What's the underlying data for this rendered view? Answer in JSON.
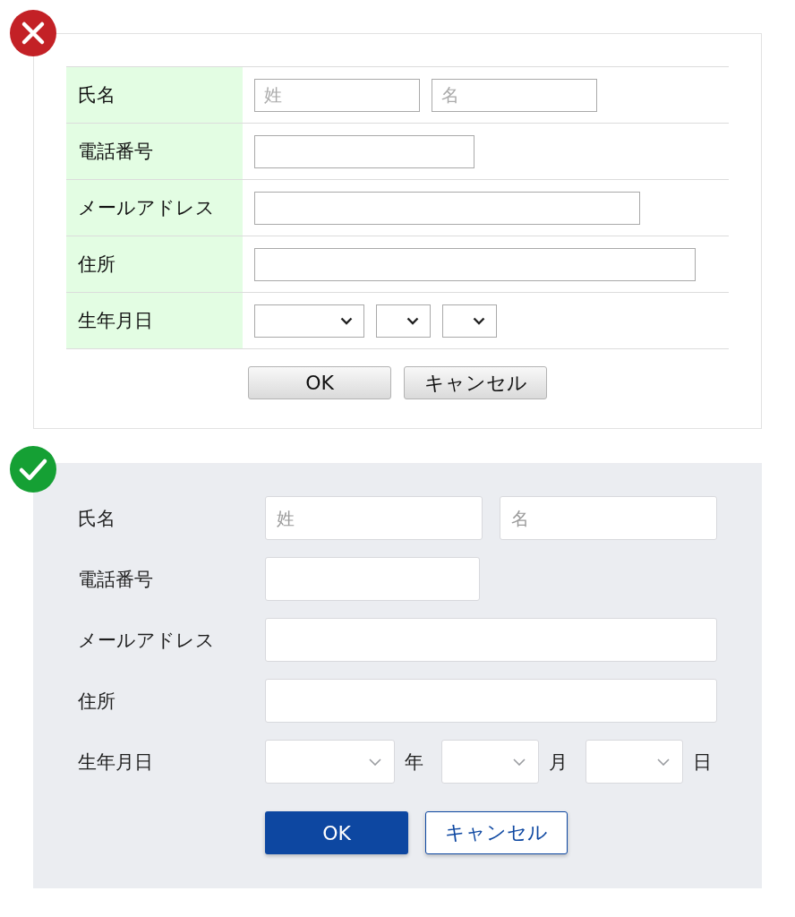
{
  "examples": [
    {
      "kind": "bad",
      "rows": [
        {
          "label": "氏名",
          "kind": "pair",
          "controls": [
            {
              "kind": "text",
              "placeholder": "姓"
            },
            {
              "kind": "text",
              "placeholder": "名"
            }
          ]
        },
        {
          "label": "電話番号",
          "kind": "short",
          "controls": [
            {
              "kind": "text"
            }
          ]
        },
        {
          "label": "メールアドレス",
          "kind": "wide",
          "controls": [
            {
              "kind": "text"
            }
          ]
        },
        {
          "label": "住所",
          "kind": "full",
          "controls": [
            {
              "kind": "text"
            }
          ]
        },
        {
          "label": "生年月日",
          "kind": "date",
          "controls": [
            {
              "kind": "select"
            },
            {
              "kind": "select"
            },
            {
              "kind": "select"
            }
          ]
        }
      ],
      "buttons": [
        {
          "label": "OK"
        },
        {
          "label": "キャンセル"
        }
      ]
    },
    {
      "kind": "good",
      "rows": [
        {
          "label": "氏名",
          "kind": "pair",
          "controls": [
            {
              "kind": "text",
              "placeholder": "姓"
            },
            {
              "kind": "text",
              "placeholder": "名"
            }
          ]
        },
        {
          "label": "電話番号",
          "kind": "short",
          "controls": [
            {
              "kind": "text"
            }
          ]
        },
        {
          "label": "メールアドレス",
          "kind": "full",
          "controls": [
            {
              "kind": "text"
            }
          ]
        },
        {
          "label": "住所",
          "kind": "full",
          "controls": [
            {
              "kind": "text"
            }
          ]
        },
        {
          "label": "生年月日",
          "kind": "date",
          "controls": [
            {
              "kind": "select",
              "suffix": "年"
            },
            {
              "kind": "select",
              "suffix": "月"
            },
            {
              "kind": "select",
              "suffix": "日"
            }
          ]
        }
      ],
      "buttons": [
        {
          "label": "OK",
          "kind": "primary"
        },
        {
          "label": "キャンセル",
          "kind": "secondary"
        }
      ]
    }
  ]
}
